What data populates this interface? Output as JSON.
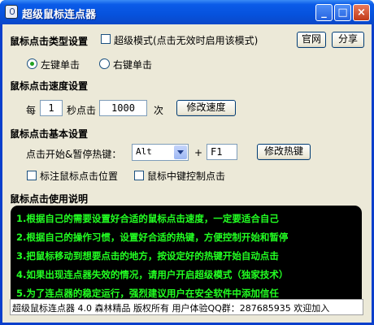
{
  "window": {
    "title": "超级鼠标连点器",
    "controls": {
      "minimize": "_",
      "maximize": "□",
      "close": "×"
    }
  },
  "click_type": {
    "heading": "鼠标点击类型设置",
    "super_mode_label": "超级模式(点击无效时启用该模式)",
    "super_mode_checked": false,
    "website_button": "官网",
    "share_button": "分享",
    "options": [
      {
        "label": "左键单击",
        "selected": true
      },
      {
        "label": "右键单击",
        "selected": false
      }
    ]
  },
  "click_speed": {
    "heading": "鼠标点击速度设置",
    "prefix": "每",
    "seconds_value": "1",
    "middle": "秒点击",
    "count_value": "1000",
    "suffix": "次",
    "modify_button": "修改速度"
  },
  "basic": {
    "heading": "鼠标点击基本设置",
    "hotkey_label": "点击开始&暂停热键：",
    "modifier_value": "Alt",
    "plus": "+",
    "key_value": "F1",
    "modify_hotkey_button": "修改热键",
    "mark_position_label": "标注鼠标点击位置",
    "mark_position_checked": false,
    "middle_button_label": "鼠标中键控制点击",
    "middle_button_checked": false
  },
  "instructions": {
    "heading": "鼠标点击使用说明",
    "lines": [
      "1.根据自己的需要设置好合适的鼠标点击速度，一定要适合自己",
      "2.根据自己的操作习惯，设置好合适的热键，方便控制开始和暂停",
      "3.把鼠标移动到想要点击的地方，按设定好的热键开始自动点击",
      "4.如果出现连点器失效的情况，请用户开启超级模式（独家技术）",
      "5.为了连点器的稳定运行，强烈建议用户在安全软件中添加信任"
    ],
    "text_color": "#22ff22"
  },
  "status_bar": {
    "text": "超级鼠标连点器 4.0 森林精品 版权所有 用户体验QQ群：287685935 欢迎加入"
  }
}
